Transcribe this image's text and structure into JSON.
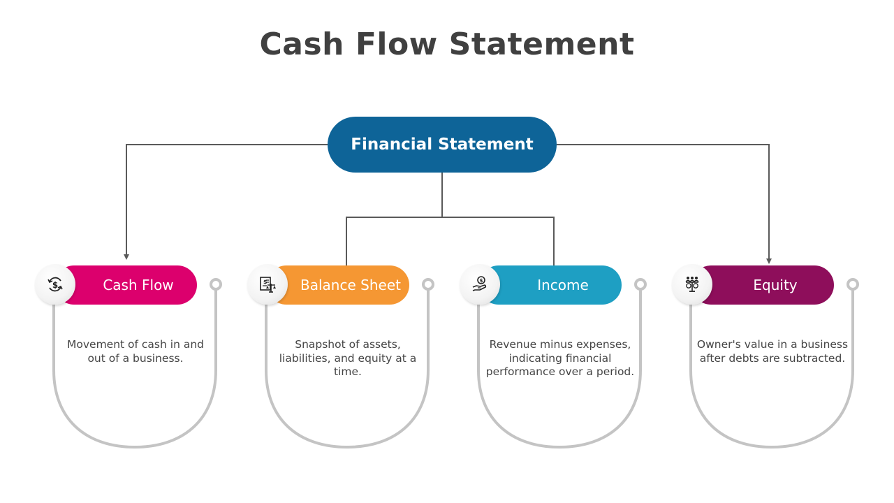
{
  "title": "Cash Flow Statement",
  "root": {
    "label": "Financial Statement",
    "color": "#0e6498"
  },
  "cards": [
    {
      "label": "Cash Flow",
      "icon": "cash-cycle-icon",
      "color": "#dc006d",
      "description": "Movement of cash in and out of a business."
    },
    {
      "label": "Balance Sheet",
      "icon": "balance-document-icon",
      "color": "#f59733",
      "description": "Snapshot of assets, liabilities, and equity at a time."
    },
    {
      "label": "Income",
      "icon": "hand-coin-icon",
      "color": "#1e9fc3",
      "description": "Revenue minus expenses, indicating financial performance over a period."
    },
    {
      "label": "Equity",
      "icon": "people-scale-icon",
      "color": "#8e0e5b",
      "description": "Owner's value in a business after debts are subtracted."
    }
  ],
  "colors": {
    "connector": "#5a5a5a",
    "outline": "#c4c4c4",
    "text": "#444444",
    "title": "#404040"
  }
}
